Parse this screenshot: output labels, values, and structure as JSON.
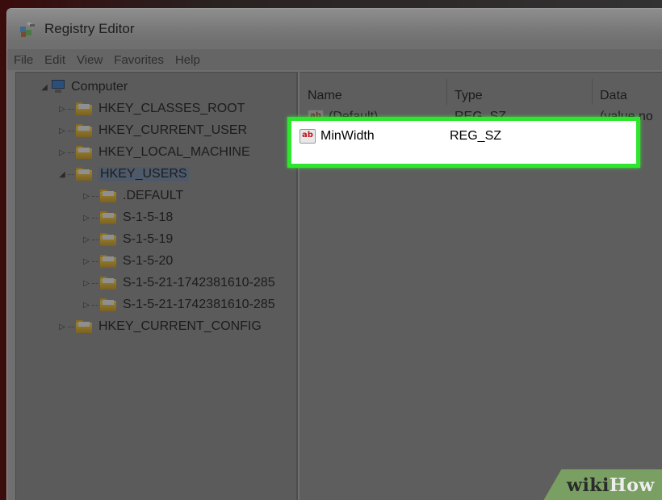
{
  "window": {
    "title": "Registry Editor",
    "app_icon": "registry-editor-icon"
  },
  "menu": [
    "File",
    "Edit",
    "View",
    "Favorites",
    "Help"
  ],
  "tree": {
    "root": "Computer",
    "hives": [
      "HKEY_CLASSES_ROOT",
      "HKEY_CURRENT_USER",
      "HKEY_LOCAL_MACHINE",
      "HKEY_USERS"
    ],
    "users_children": [
      ".DEFAULT",
      "S-1-5-18",
      "S-1-5-19",
      "S-1-5-20",
      "S-1-5-21-1742381610-285",
      "S-1-5-21-1742381610-285"
    ],
    "last_hive": "HKEY_CURRENT_CONFIG"
  },
  "list": {
    "columns": [
      "Name",
      "Type",
      "Data"
    ],
    "rows": [
      {
        "name": "(Default)",
        "type": "REG_SZ",
        "data": "(value no"
      },
      {
        "name": "MinWidth",
        "type": "REG_SZ",
        "data": ""
      }
    ]
  },
  "badge": {
    "wiki": "wiki",
    "how": "How"
  },
  "colors": {
    "highlight": "#2ee62e",
    "badge_bg": "#7a9f62"
  }
}
